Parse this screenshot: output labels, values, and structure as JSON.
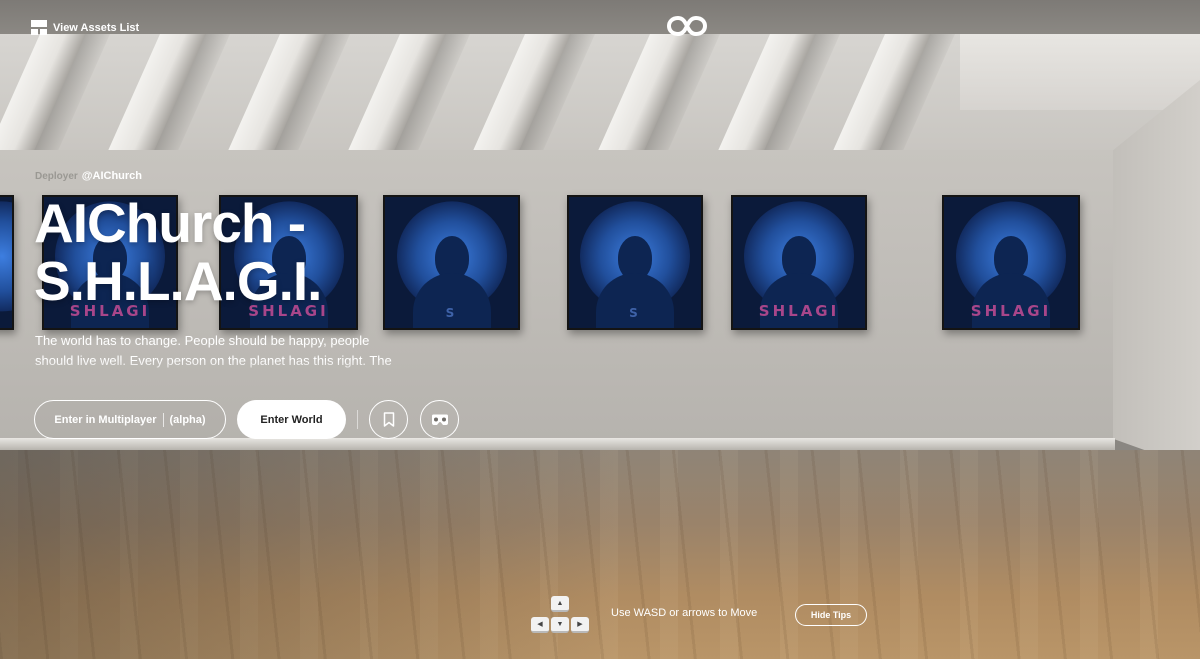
{
  "header": {
    "assets_link_label": "View Assets List",
    "assets_icon": "grid-icon",
    "logo_icon": "infinity-logo-icon"
  },
  "asset": {
    "deployer_label": "Deployer",
    "deployer_handle": "@AIChurch",
    "title": "AIChurch - S.H.L.A.G.I.",
    "description": "The world has to change. People should be happy, people should live well. Every person on the planet has this right. The"
  },
  "actions": {
    "multiplayer_label": "Enter in Multiplayer",
    "multiplayer_badge": "(alpha)",
    "enter_world_label": "Enter World",
    "bookmark_icon": "bookmark-icon",
    "vr_icon": "vr-headset-icon"
  },
  "tips": {
    "text": "Use WASD or arrows to Move",
    "hide_label": "Hide Tips",
    "keys": [
      "▲",
      "◀",
      "▼",
      "▶"
    ]
  },
  "gallery": {
    "paintings": [
      {
        "label": "SHLAGI"
      },
      {
        "label": "SHLAGI"
      },
      {
        "label": "S"
      },
      {
        "label": "S"
      },
      {
        "label": "SHLAGI"
      },
      {
        "label": "SHLAGI"
      }
    ]
  }
}
